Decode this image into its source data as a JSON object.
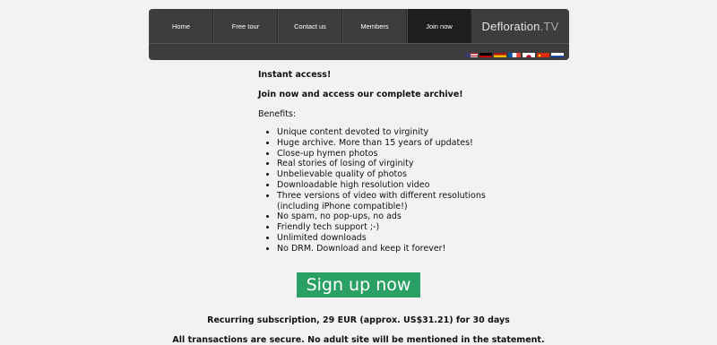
{
  "nav": {
    "items": [
      {
        "label": "Home"
      },
      {
        "label": "Free tour"
      },
      {
        "label": "Contact us"
      },
      {
        "label": "Members"
      },
      {
        "label": "Join now"
      }
    ],
    "brand_main": "Defloration",
    "brand_tld": ".TV",
    "flags": [
      "us-flag-icon",
      "de-flag-icon",
      "es-flag-icon",
      "fr-flag-icon",
      "jp-flag-icon",
      "cn-flag-icon",
      "ru-flag-icon"
    ]
  },
  "main": {
    "heading1": "Instant access!",
    "heading2": "Join now and access our complete archive!",
    "benefits_label": "Benefits:",
    "benefits": [
      "Unique content devoted to virginity",
      "Huge archive. More than 15 years of updates!",
      "Close-up hymen photos",
      "Real stories of losing of virginity",
      "Unbelievable quality of photos",
      "Downloadable high resolution video",
      "Three versions of video with different resolutions (including iPhone compatible!)",
      "No spam, no pop-ups, no ads",
      "Friendly tech support ;-)",
      "Unlimited downloads",
      "No DRM. Download and keep it forever!"
    ],
    "signup_label": "Sign up now",
    "subscription_text": "Recurring subscription, 29 EUR (approx. US$31.21) for 30 days",
    "secure_text": "All transactions are secure. No adult site will be mentioned in the statement."
  },
  "colors": {
    "signup": "#2aa065",
    "nav_bg": "#3d3d3d",
    "active_tab": "#1e1e1e"
  }
}
